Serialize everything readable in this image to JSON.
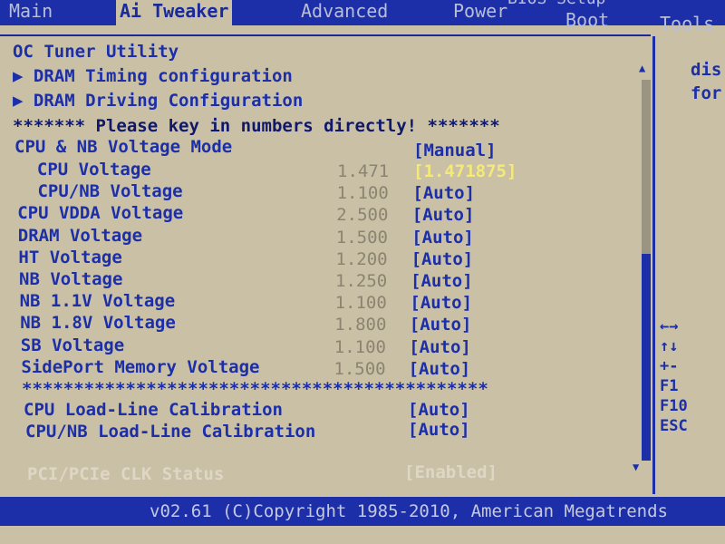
{
  "tabs": [
    {
      "label": "Main"
    },
    {
      "label": "Ai Tweaker",
      "selected": true
    },
    {
      "label": "Advanced"
    },
    {
      "label": "Power"
    },
    {
      "label": "Boot"
    },
    {
      "label": "Tools"
    }
  ],
  "title": "BIOS Setup",
  "menu": {
    "submenus": [
      "OC Tuner Utility",
      "▶ DRAM Timing configuration",
      "▶ DRAM Driving Configuration"
    ],
    "notice": "******* Please key in numbers directly! *******",
    "mode": {
      "label": "CPU & NB Voltage Mode",
      "value": "[Manual]"
    },
    "items": [
      {
        "label": "  CPU Voltage",
        "current": "1.471",
        "value": "[1.471875]",
        "highlight": true
      },
      {
        "label": "  CPU/NB Voltage",
        "current": "1.100",
        "value": "[Auto]"
      },
      {
        "label": "CPU VDDA Voltage",
        "current": "2.500",
        "value": "[Auto]"
      },
      {
        "label": "DRAM Voltage",
        "current": "1.500",
        "value": "[Auto]"
      },
      {
        "label": "HT Voltage",
        "current": "1.200",
        "value": "[Auto]"
      },
      {
        "label": "NB Voltage",
        "current": "1.250",
        "value": "[Auto]"
      },
      {
        "label": "NB 1.1V Voltage",
        "current": "1.100",
        "value": "[Auto]"
      },
      {
        "label": "NB 1.8V Voltage",
        "current": "1.800",
        "value": "[Auto]"
      },
      {
        "label": "SB Voltage",
        "current": "1.100",
        "value": "[Auto]"
      },
      {
        "label": "SidePort Memory Voltage",
        "current": "1.500",
        "value": "[Auto]"
      }
    ],
    "separator": "*********************************************",
    "llc": [
      {
        "label": "CPU Load-Line Calibration",
        "value": "[Auto]"
      },
      {
        "label": "CPU/NB Load-Line Calibration",
        "value": "[Auto]"
      }
    ],
    "disabled": {
      "label": "PCI/PCIe CLK Status",
      "value": "[Enabled]"
    }
  },
  "help": {
    "lines": [
      "dis",
      "for"
    ],
    "keys": [
      "←→",
      "↑↓",
      "+-",
      "F1",
      "F10",
      "ESC"
    ]
  },
  "scroll_position_percent": 100,
  "footer": "v02.61 (C)Copyright 1985-2010, American Megatrends"
}
